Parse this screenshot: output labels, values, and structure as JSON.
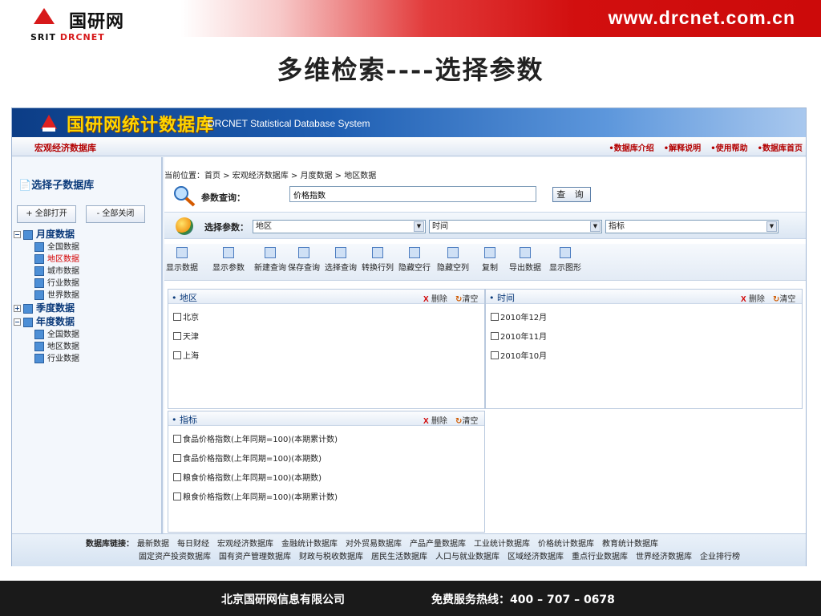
{
  "slide": {
    "logo_cn": "国研网",
    "logo_en_1": "SRIT",
    "logo_en_2": "DRCNET",
    "url": "www.drcnet.com.cn",
    "title": "多维检索----选择参数",
    "footer_company": "北京国研网信息有限公司",
    "footer_hotline": "免费服务热线：400 – 707 – 0678",
    "colors": {
      "header_red": "#d20f0f",
      "footer_bg": "#1a1a1a"
    }
  },
  "app": {
    "banner_title": "国研网统计数据库",
    "banner_subtitle": "DRCNET Statistical Database System",
    "database_name": "宏观经济数据库",
    "top_links": [
      "•数据库介绍",
      "•解释说明",
      "•使用帮助",
      "•数据库首页"
    ],
    "sidebar": {
      "title": "选择子数据库",
      "expand_all": "+ 全部打开",
      "collapse_all": "- 全部关闭",
      "tree": [
        {
          "level": 0,
          "toggle": "−",
          "label": "月度数据"
        },
        {
          "level": 1,
          "label": "全国数据"
        },
        {
          "level": 1,
          "label": "地区数据",
          "selected": true
        },
        {
          "level": 1,
          "label": "城市数据"
        },
        {
          "level": 1,
          "label": "行业数据"
        },
        {
          "level": 1,
          "label": "世界数据"
        },
        {
          "level": 0,
          "toggle": "+",
          "label": "季度数据"
        },
        {
          "level": 0,
          "toggle": "−",
          "label": "年度数据"
        },
        {
          "level": 1,
          "label": "全国数据"
        },
        {
          "level": 1,
          "label": "地区数据"
        },
        {
          "level": 1,
          "label": "行业数据"
        }
      ]
    },
    "breadcrumb": "当前位置：首页 > 宏观经济数据库 > 月度数据 > 地区数据",
    "query": {
      "label": "参数查询：",
      "value": "价格指数",
      "button": "查 询"
    },
    "params": {
      "label": "选择参数：",
      "selects": [
        "地区",
        "时间",
        "指标"
      ]
    },
    "toolbar": [
      "显示数据",
      "显示参数",
      "新建查询",
      "保存查询",
      "选择查询",
      "转换行列",
      "隐藏空行",
      "隐藏空列",
      "复制",
      "导出数据",
      "显示图形"
    ],
    "panels": {
      "delete_label": "删除",
      "delete_mark": "X",
      "clear_label": "清空",
      "clear_mark": "↻",
      "region": {
        "title": "• 地区",
        "items": [
          "北京",
          "天津",
          "上海"
        ]
      },
      "time": {
        "title": "• 时间",
        "items": [
          "2010年12月",
          "2010年11月",
          "2010年10月"
        ]
      },
      "indicator": {
        "title": "• 指标",
        "items": [
          "食品价格指数(上年同期=100)(本期累计数)",
          "食品价格指数(上年同期=100)(本期数)",
          "粮食价格指数(上年同期=100)(本期数)",
          "粮食价格指数(上年同期=100)(本期累计数)"
        ]
      }
    },
    "footer_links": {
      "label": "数据库链接：",
      "row1": [
        "最新数据",
        "每日财经",
        "宏观经济数据库",
        "金融统计数据库",
        "对外贸易数据库",
        "产品产量数据库",
        "工业统计数据库",
        "价格统计数据库",
        "教育统计数据库"
      ],
      "row2": [
        "固定资产投资数据库",
        "国有资产管理数据库",
        "财政与税收数据库",
        "居民生活数据库",
        "人口与就业数据库",
        "区域经济数据库",
        "重点行业数据库",
        "世界经济数据库",
        "企业排行榜"
      ]
    }
  }
}
